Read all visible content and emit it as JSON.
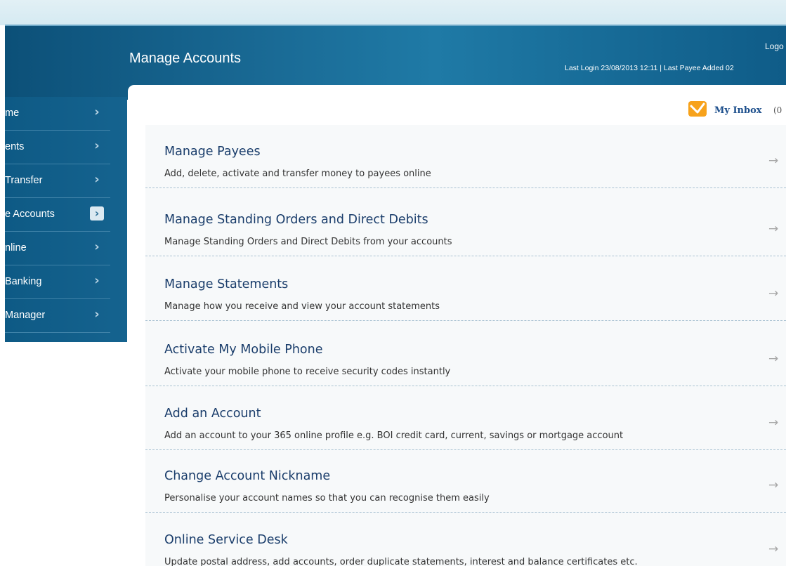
{
  "header": {
    "title": "Manage Accounts",
    "logout_label": "Logo",
    "last_login": "Last Login 23/08/2013 12:11 | Last Payee Added 02"
  },
  "sidebar": {
    "items": [
      {
        "label": "me",
        "active": false
      },
      {
        "label": "ents",
        "active": false
      },
      {
        "label": "Transfer",
        "active": false
      },
      {
        "label": "e Accounts",
        "active": true
      },
      {
        "label": "nline",
        "active": false
      },
      {
        "label": "Banking",
        "active": false
      },
      {
        "label": "Manager",
        "active": false
      }
    ],
    "chevron_glyph": "›"
  },
  "inbox": {
    "label": "My Inbox",
    "count": "(0",
    "icon": "envelope-check-icon",
    "icon_color": "#f7a21b"
  },
  "rows": [
    {
      "title": "Manage Payees",
      "description": "Add, delete, activate and transfer money to payees online"
    },
    {
      "title": "Manage Standing Orders and Direct Debits",
      "description": "Manage Standing Orders and Direct Debits from your accounts"
    },
    {
      "title": "Manage Statements",
      "description": "Manage how you receive and view your account statements"
    },
    {
      "title": "Activate My Mobile Phone",
      "description": "Activate your mobile phone to receive security codes instantly"
    },
    {
      "title": "Add an Account",
      "description": "Add an account to your 365 online profile e.g. BOI credit card, current, savings or mortgage account"
    },
    {
      "title": "Change Account Nickname",
      "description": "Personalise your account names so that you can recognise them easily"
    },
    {
      "title": "Online Service Desk",
      "description": "Update postal address, add accounts, order duplicate statements, interest and balance certificates etc."
    }
  ],
  "row_arrow_glyph": "→",
  "colors": {
    "header_bg": "#15638f",
    "row_title": "#1a3d6b",
    "inbox_accent": "#f7a21b"
  }
}
